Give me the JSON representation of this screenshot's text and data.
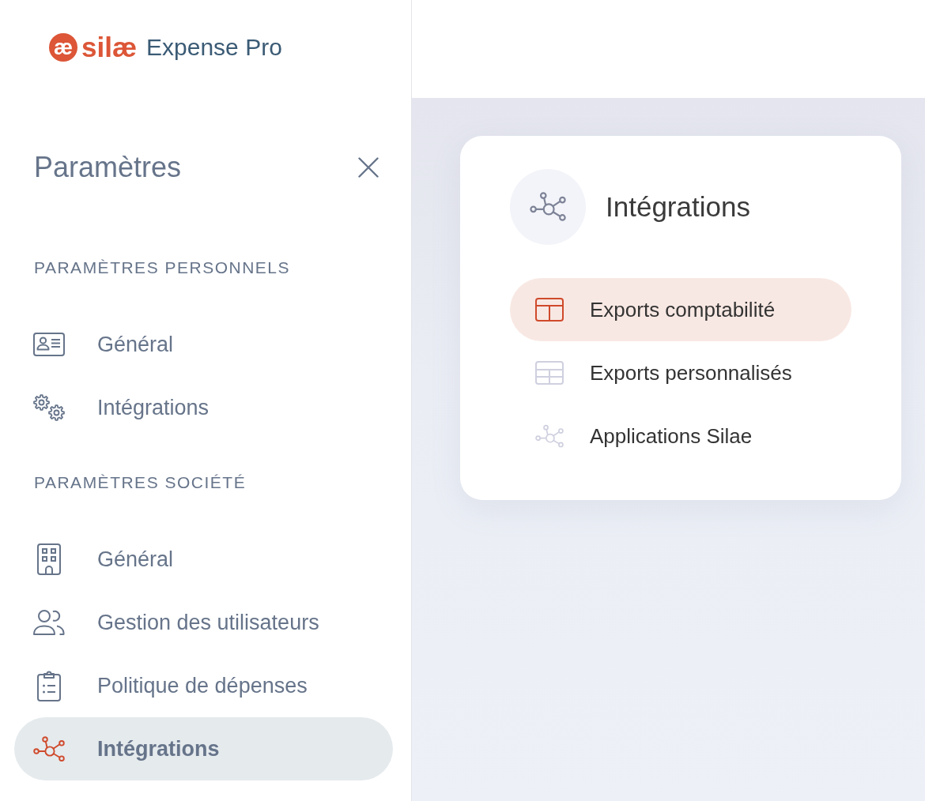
{
  "logo": {
    "mark": "æ",
    "brand": "silæ",
    "product": "Expense Pro"
  },
  "sidebar": {
    "title": "Paramètres",
    "sections": [
      {
        "heading": "PARAMÈTRES PERSONNELS",
        "items": [
          {
            "label": "Général",
            "selected": false
          },
          {
            "label": "Intégrations",
            "selected": false
          }
        ]
      },
      {
        "heading": "PARAMÈTRES SOCIÉTÉ",
        "items": [
          {
            "label": "Général",
            "selected": false
          },
          {
            "label": "Gestion des utilisateurs",
            "selected": false
          },
          {
            "label": "Politique de dépenses",
            "selected": false
          },
          {
            "label": "Intégrations",
            "selected": true
          }
        ]
      }
    ]
  },
  "panel": {
    "title": "Intégrations",
    "items": [
      {
        "label": "Exports comptabilité",
        "selected": true
      },
      {
        "label": "Exports personnalisés",
        "selected": false
      },
      {
        "label": "Applications Silae",
        "selected": false
      }
    ]
  }
}
